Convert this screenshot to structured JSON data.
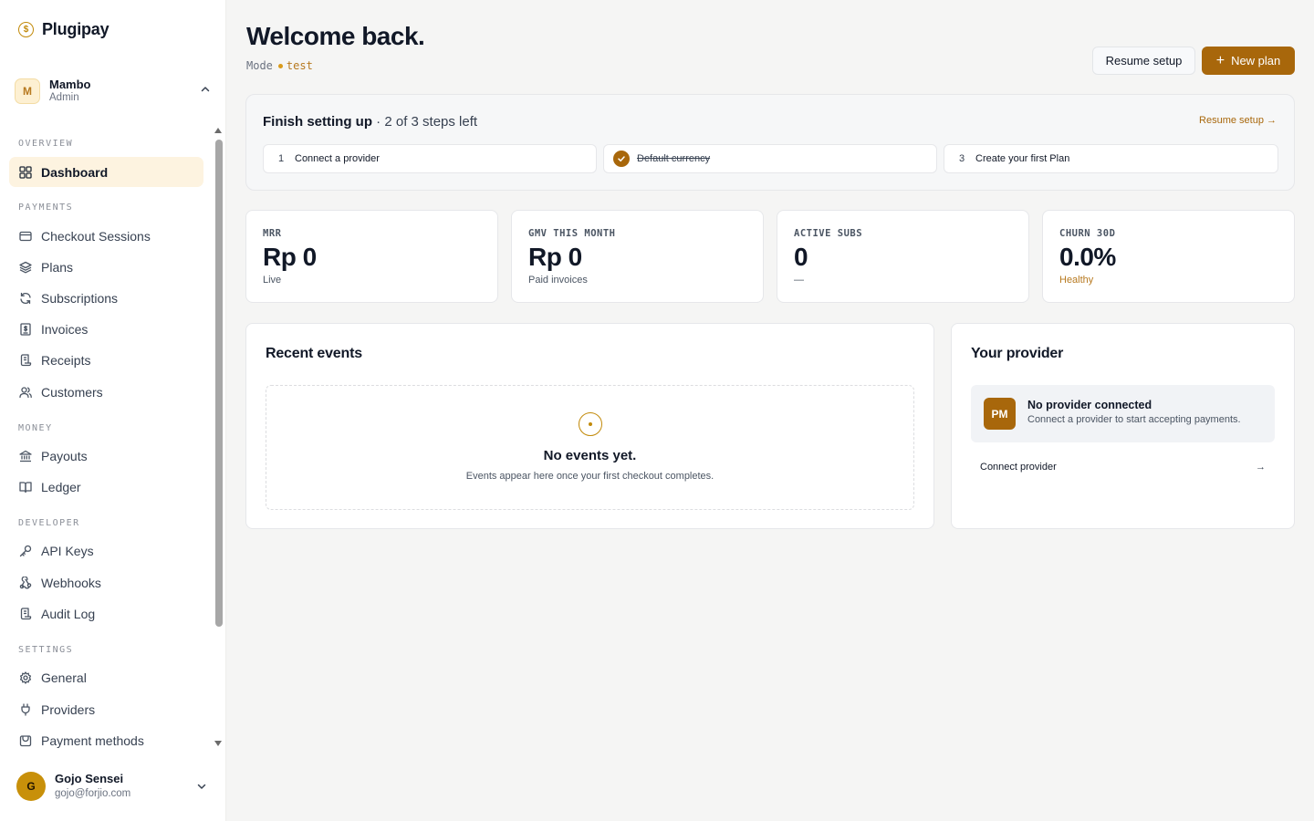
{
  "brand": {
    "name": "Plugipay",
    "icon": "dollar-coin-icon"
  },
  "workspace": {
    "initial": "M",
    "name": "Mambo",
    "role": "Admin"
  },
  "nav": {
    "sections": {
      "overview": "OVERVIEW",
      "payments": "PAYMENTS",
      "money": "MONEY",
      "developer": "DEVELOPER",
      "settings": "SETTINGS"
    },
    "items": {
      "dashboard": "Dashboard",
      "checkout_sessions": "Checkout Sessions",
      "plans": "Plans",
      "subscriptions": "Subscriptions",
      "invoices": "Invoices",
      "receipts": "Receipts",
      "customers": "Customers",
      "payouts": "Payouts",
      "ledger": "Ledger",
      "api_keys": "API Keys",
      "webhooks": "Webhooks",
      "audit_log": "Audit Log",
      "general": "General",
      "providers": "Providers",
      "payment_methods": "Payment methods"
    },
    "active": "dashboard"
  },
  "user": {
    "initial": "G",
    "name": "Gojo Sensei",
    "email": "gojo@forjio.com"
  },
  "header": {
    "title": "Welcome back.",
    "mode_label": "Mode",
    "mode_value": "test",
    "resume_button": "Resume setup",
    "new_plan_button": "New plan"
  },
  "setup": {
    "title": "Finish setting up",
    "separator": "·",
    "steps_left": "2 of 3 steps left",
    "link": "Resume setup →",
    "steps": [
      {
        "num": "1",
        "label": "Connect a provider",
        "done": false
      },
      {
        "num": "",
        "label": "Default currency",
        "done": true
      },
      {
        "num": "3",
        "label": "Create your first Plan",
        "done": false
      }
    ]
  },
  "stats": [
    {
      "label": "MRR",
      "value": "Rp 0",
      "sub": "Live"
    },
    {
      "label": "GMV THIS MONTH",
      "value": "Rp 0",
      "sub": "Paid invoices"
    },
    {
      "label": "ACTIVE SUBS",
      "value": "0",
      "sub": "—"
    },
    {
      "label": "CHURN 30D",
      "value": "0.0%",
      "sub": "Healthy"
    }
  ],
  "events": {
    "title": "Recent events",
    "empty_title": "No events yet.",
    "empty_sub": "Events appear here once your first checkout completes."
  },
  "provider": {
    "title": "Your provider",
    "badge": "PM",
    "status_title": "No provider connected",
    "status_sub": "Connect a provider to start accepting payments.",
    "connect_label": "Connect provider",
    "connect_arrow": "→"
  },
  "colors": {
    "accent": "#a8670b",
    "accent_light": "#fdf3e0",
    "gold": "#c28a0a"
  }
}
